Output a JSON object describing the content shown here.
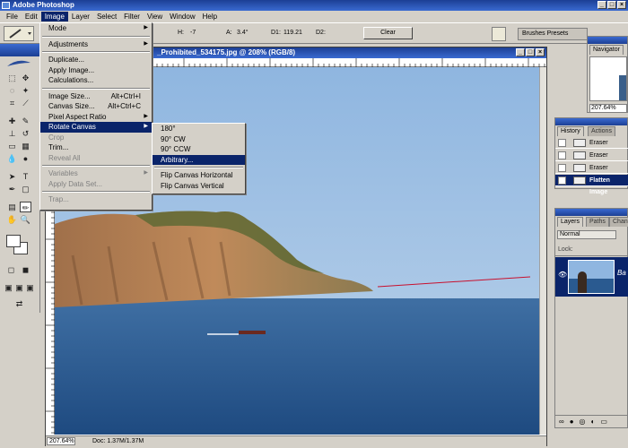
{
  "app": {
    "title": "Adobe Photoshop"
  },
  "window_controls": {
    "minimize": "_",
    "maximize": "□",
    "close": "×"
  },
  "menubar": [
    "File",
    "Edit",
    "Image",
    "Layer",
    "Select",
    "Filter",
    "View",
    "Window",
    "Help"
  ],
  "menubar_active": "Image",
  "options": {
    "h_label": "H:",
    "h_value": "-7",
    "a_label": "A:",
    "a_value": "3.4°",
    "d1_label": "D1:",
    "d1_value": "119.21",
    "d2_label": "D2:",
    "clear_label": "Clear",
    "palette_tabs": "Brushes  Presets"
  },
  "document": {
    "title": "_Prohibited_534175.jpg @ 208% (RGB/8)",
    "zoom": "207.64%",
    "doc_info": "Doc: 1.37M/1.37M"
  },
  "image_menu": [
    {
      "label": "Mode",
      "submenu": true
    },
    {
      "sep": true
    },
    {
      "label": "Adjustments",
      "submenu": true
    },
    {
      "sep": true
    },
    {
      "label": "Duplicate..."
    },
    {
      "label": "Apply Image..."
    },
    {
      "label": "Calculations..."
    },
    {
      "sep": true
    },
    {
      "label": "Image Size...",
      "shortcut": "Alt+Ctrl+I"
    },
    {
      "label": "Canvas Size...",
      "shortcut": "Alt+Ctrl+C"
    },
    {
      "label": "Pixel Aspect Ratio",
      "submenu": true
    },
    {
      "label": "Rotate Canvas",
      "submenu": true,
      "selected": true
    },
    {
      "label": "Crop",
      "disabled": true
    },
    {
      "label": "Trim..."
    },
    {
      "label": "Reveal All",
      "disabled": true
    },
    {
      "sep": true
    },
    {
      "label": "Variables",
      "submenu": true,
      "disabled": true
    },
    {
      "label": "Apply Data Set...",
      "disabled": true
    },
    {
      "sep": true
    },
    {
      "label": "Trap...",
      "disabled": true
    }
  ],
  "rotate_submenu": [
    {
      "label": "180°"
    },
    {
      "label": "90° CW"
    },
    {
      "label": "90° CCW"
    },
    {
      "label": "Arbitrary...",
      "selected": true
    },
    {
      "sep": true
    },
    {
      "label": "Flip Canvas Horizontal"
    },
    {
      "label": "Flip Canvas Vertical"
    }
  ],
  "navigator": {
    "tab": "Navigator",
    "zoom": "207.64%"
  },
  "history": {
    "tabs": [
      "History",
      "Actions"
    ],
    "items": [
      {
        "label": "Eraser"
      },
      {
        "label": "Eraser"
      },
      {
        "label": "Eraser"
      },
      {
        "label": "Flatten Image",
        "selected": true
      }
    ]
  },
  "layers": {
    "tabs": [
      "Layers",
      "Paths",
      "Chann"
    ],
    "blend_mode": "Normal",
    "lock_label": "Lock:",
    "layer_name": "Ba"
  },
  "colors": {
    "titlebar": "#1c3f94",
    "selection": "#0a246a",
    "chrome": "#d4d0c8",
    "measure_line": "#c8102e"
  }
}
